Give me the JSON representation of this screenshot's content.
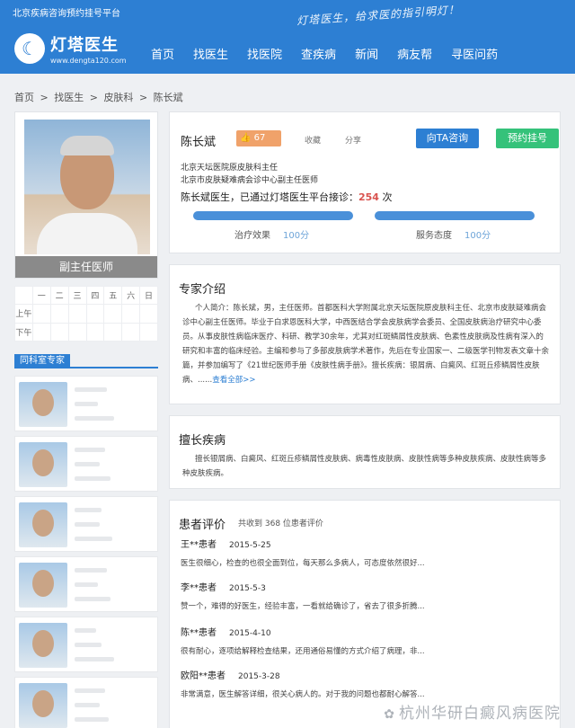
{
  "header": {
    "tagline": "北京疾病咨询预约挂号平台",
    "slogan": "灯塔医生，给求医的指引明灯！",
    "logo_name": "灯塔医生",
    "logo_url": "www.dengta120.com",
    "logo_icon": "rabbit-logo-icon",
    "nav": [
      "首页",
      "找医生",
      "找医院",
      "查疾病",
      "新闻",
      "病友帮",
      "寻医问药"
    ]
  },
  "breadcrumb": [
    "首页",
    ">",
    "找医生",
    ">",
    "皮肤科",
    ">",
    "陈长斌"
  ],
  "sidebar": {
    "doctor_title": "副主任医师",
    "schedule": {
      "days": [
        "一",
        "二",
        "三",
        "四",
        "五",
        "六",
        "日"
      ],
      "rows": [
        "上午",
        "下午"
      ]
    },
    "dept_header": "同科室专家"
  },
  "profile": {
    "name": "陈长斌",
    "likes": "67",
    "like_icon": "thumbs-up-icon",
    "favorite": "收藏",
    "share": "分享",
    "consult_button": "向TA咨询",
    "book_button": "预约挂号",
    "affiliation_1": "北京天坛医院原皮肤科主任",
    "affiliation_2": "北京市皮肤疑难病会诊中心副主任医师",
    "visits_prefix": "陈长斌医生，已通过灯塔医生平台接诊：",
    "visits_count": "254",
    "visits_suffix": " 次",
    "treatment_label": "治疗效果",
    "treatment_score": "100分",
    "treatment_value": 100,
    "attitude_label": "服务态度",
    "attitude_score": "100分",
    "attitude_value": 100,
    "colors": {
      "primary": "#2d7fd3",
      "book": "#35c27a",
      "like": "#f0a26a"
    }
  },
  "intro": {
    "title": "专家介绍",
    "text": "个人简介：陈长斌，男，主任医师。首都医科大学附属北京天坛医院原皮肤科主任、北京市皮肤疑难病会诊中心副主任医师。毕业于白求恩医科大学，中西医结合学会皮肤病学会委员、全国皮肤病治疗研究中心委员。从事皮肤性病临床医疗、科研、教学30余年，尤其对红斑鳞屑性皮肤病、色素性皮肤病及性病有深入的研究和丰富的临床经验。主编和参与了多部皮肤病学术著作，先后在专业国家一、二级医学刊物发表文章十余篇，并参加编写了《21世纪医师手册《皮肤性病手册》。擅长疾病：银屑病、白癜风、红斑丘疹鳞屑性皮肤病、......",
    "more": "查看全部>>"
  },
  "speciality": {
    "title": "擅长疾病",
    "text": "擅长银屑病、白癜风、红斑丘疹鳞屑性皮肤病、病毒性皮肤病、皮肤性病等多种皮肤疾病、皮肤性病等多种皮肤疾病。"
  },
  "reviews": {
    "title": "患者评价",
    "count_text": "共收到 368 位患者评价",
    "items": [
      {
        "user": "王**患者",
        "date": "2015-5-25",
        "text": "医生很细心，检查的也很全面到位，每天那么多病人，可态度依然很好..."
      },
      {
        "user": "李**患者",
        "date": "2015-5-3",
        "text": "赞一个，难得的好医生，经验丰富，一看就给确诊了，省去了很多折腾..."
      },
      {
        "user": "陈**患者",
        "date": "2015-4-10",
        "text": "很有耐心，逐项给解释检查结果，还用通俗易懂的方式介绍了病理，非..."
      },
      {
        "user": "欧阳**患者",
        "date": "2015-3-28",
        "text": "非常满意，医生解答详细，很关心病人的。对于我的问题也都耐心解答..."
      }
    ]
  },
  "watermark": "杭州华研白癜风病医院",
  "watermark_icon": "wechat-icon"
}
